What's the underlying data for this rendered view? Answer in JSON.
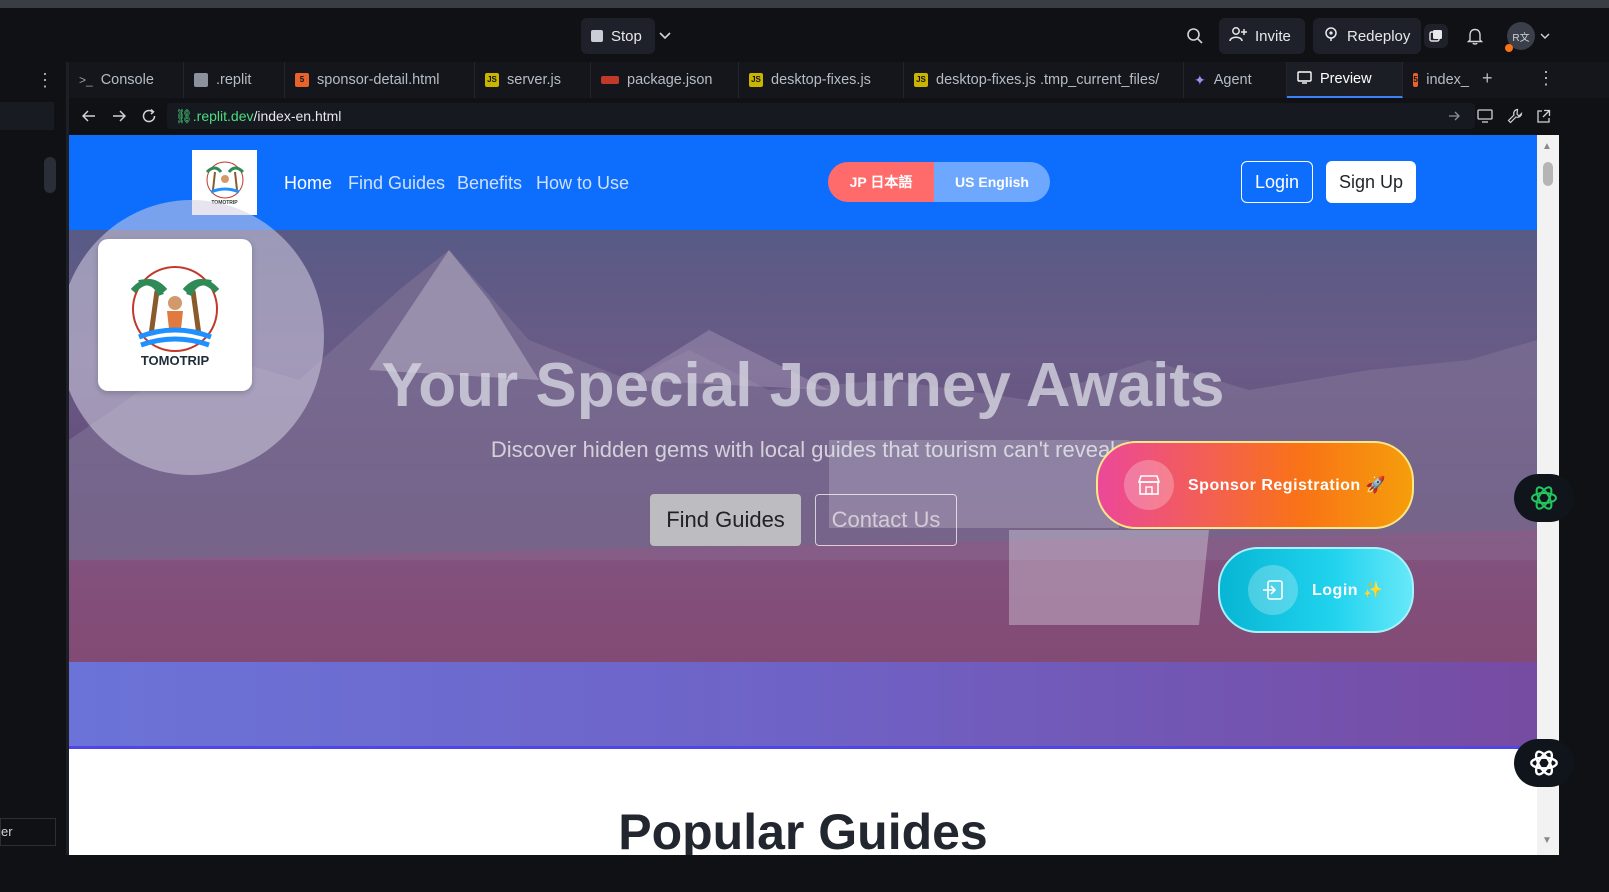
{
  "topbar": {
    "stop_label": "Stop",
    "invite_label": "Invite",
    "redeploy_label": "Redeploy",
    "avatar_text": "R文"
  },
  "tabs": [
    {
      "label": "Console",
      "icon": "terminal-icon"
    },
    {
      "label": ".replit",
      "icon": "replit-icon"
    },
    {
      "label": "sponsor-detail.html",
      "icon": "html-icon"
    },
    {
      "label": "server.js",
      "icon": "js-icon"
    },
    {
      "label": "package.json",
      "icon": "npm-icon"
    },
    {
      "label": "desktop-fixes.js",
      "icon": "js-icon"
    },
    {
      "label": "desktop-fixes.js .tmp_current_files/",
      "icon": "js-icon"
    },
    {
      "label": "Agent",
      "icon": "agent-icon"
    },
    {
      "label": "Preview",
      "icon": "preview-icon"
    },
    {
      "label": "index_",
      "icon": "html-icon"
    }
  ],
  "urlbar": {
    "domain": ".replit.dev",
    "path": "/index-en.html"
  },
  "left_strip": {
    "bottom_text": "er"
  },
  "site": {
    "nav": {
      "logo_text": "TOMOTRIP",
      "links": [
        "Home",
        "Find Guides",
        "Benefits",
        "How to Use"
      ],
      "lang_jp": "JP 日本語",
      "lang_en": "US English",
      "login": "Login",
      "signup": "Sign Up"
    },
    "hero": {
      "badge_text": "TOMOTRIP",
      "title": "Your Special Journey Awaits",
      "subtitle": "Discover hidden gems with local guides that tourism can't reveal",
      "find_guides": "Find Guides",
      "contact": "Contact Us",
      "sponsor_registration": "Sponsor Registration 🚀",
      "float_login": "Login ✨"
    },
    "section_title": "Popular Guides"
  },
  "colors": {
    "nav_blue": "#0d6efd",
    "lang_jp": "#ff6b6b",
    "lang_en": "#6ea8fe",
    "sponsor_gradient": "#ec4899 → #f59e0b",
    "login_gradient": "#06b6d4 → #22d3ee"
  }
}
